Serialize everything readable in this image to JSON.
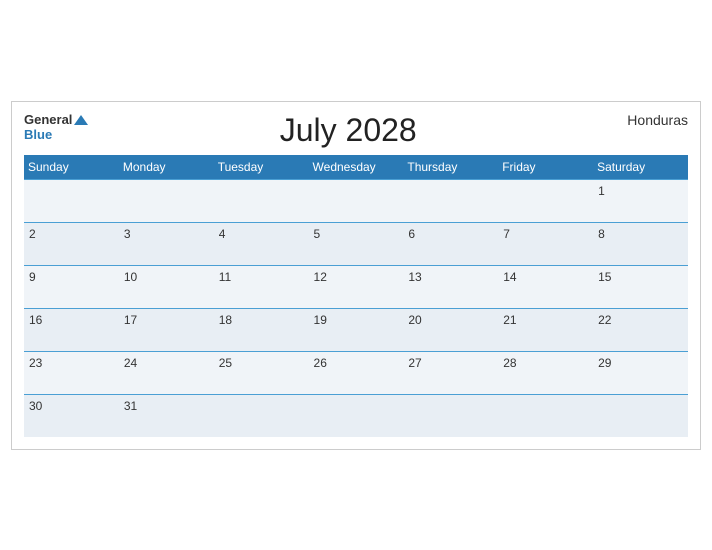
{
  "header": {
    "logo_general": "General",
    "logo_blue": "Blue",
    "title": "July 2028",
    "country": "Honduras"
  },
  "weekdays": [
    "Sunday",
    "Monday",
    "Tuesday",
    "Wednesday",
    "Thursday",
    "Friday",
    "Saturday"
  ],
  "weeks": [
    [
      "",
      "",
      "",
      "",
      "",
      "",
      "1"
    ],
    [
      "2",
      "3",
      "4",
      "5",
      "6",
      "7",
      "8"
    ],
    [
      "9",
      "10",
      "11",
      "12",
      "13",
      "14",
      "15"
    ],
    [
      "16",
      "17",
      "18",
      "19",
      "20",
      "21",
      "22"
    ],
    [
      "23",
      "24",
      "25",
      "26",
      "27",
      "28",
      "29"
    ],
    [
      "30",
      "31",
      "",
      "",
      "",
      "",
      ""
    ]
  ]
}
